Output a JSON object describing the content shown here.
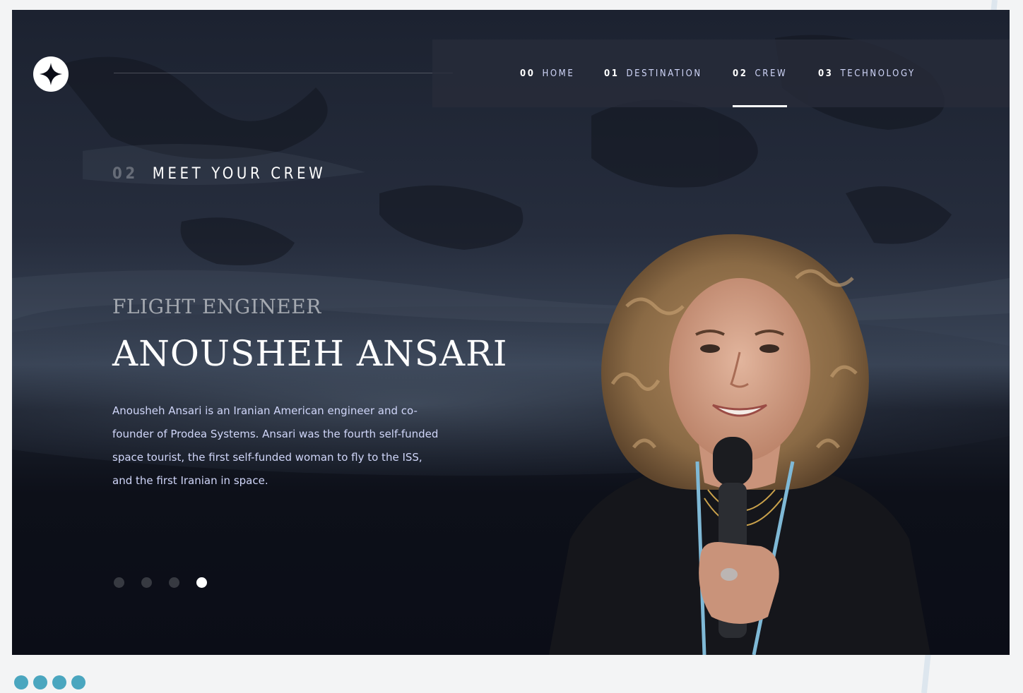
{
  "logo": {
    "icon": "star-logo-icon"
  },
  "nav": {
    "items": [
      {
        "num": "00",
        "label": "HOME",
        "active": false
      },
      {
        "num": "01",
        "label": "DESTINATION",
        "active": false
      },
      {
        "num": "02",
        "label": "CREW",
        "active": true
      },
      {
        "num": "03",
        "label": "TECHNOLOGY",
        "active": false
      }
    ]
  },
  "heading": {
    "num": "02",
    "title": "MEET YOUR CREW"
  },
  "crew": {
    "role": "FLIGHT ENGINEER",
    "name": "ANOUSHEH ANSARI",
    "bio": "Anousheh Ansari is an Iranian American engineer and co-founder of Prodea Systems. Ansari was the fourth self-funded space tourist, the first self-funded woman to fly to the ISS, and the first Iranian in space.",
    "slides": {
      "count": 4,
      "active_index": 3
    }
  },
  "footer": {
    "dots": 4
  },
  "colors": {
    "background": "#0b0d17",
    "text": "#ffffff",
    "muted": "#d0d6f9",
    "accent_dots": "#4aa6bf"
  }
}
